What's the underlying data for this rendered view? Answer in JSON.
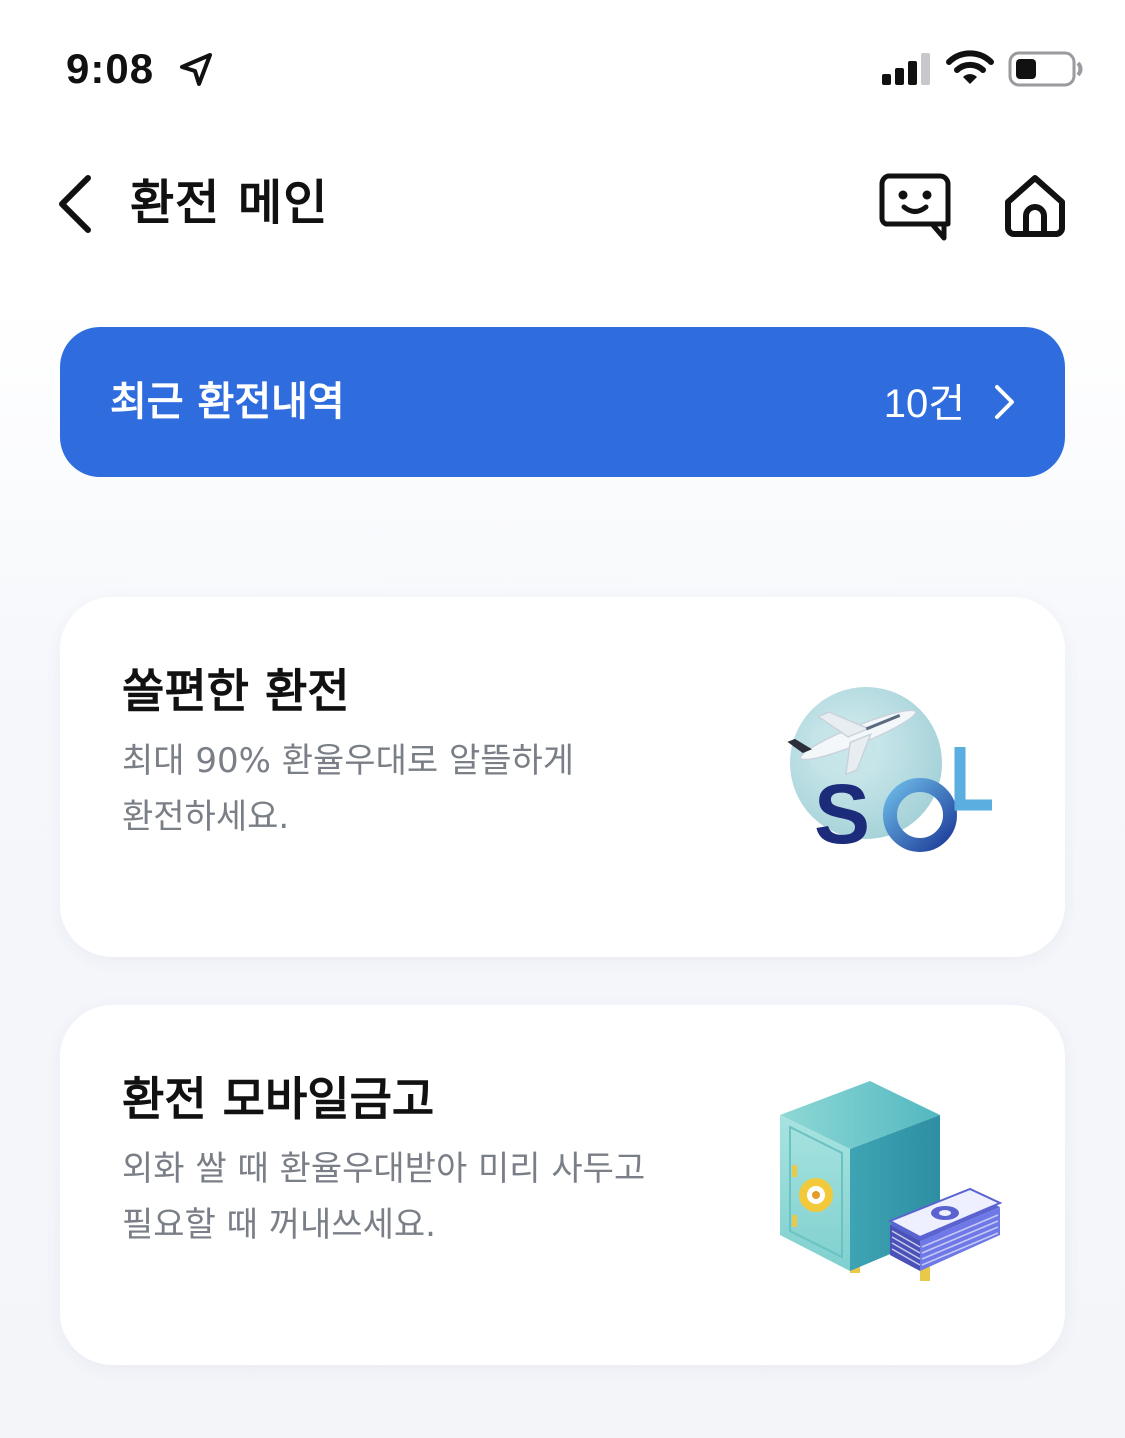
{
  "status_bar": {
    "time": "9:08",
    "icons": [
      "location-arrow-icon",
      "cellular-signal-icon",
      "wifi-icon",
      "battery-icon"
    ]
  },
  "header": {
    "title": "환전 메인",
    "back_icon": "chevron-left-icon",
    "chat_icon": "chatbot-face-icon",
    "home_icon": "home-icon"
  },
  "recent_exchange": {
    "label": "최근 환전내역",
    "count": "10건",
    "background": "#2f6ddf"
  },
  "cards": [
    {
      "title": "쏠편한 환전",
      "description_lines": [
        "최대 90% 환율우대로 알뜰하게",
        "환전하세요."
      ],
      "illustration": "sol-globe-airplane-illustration",
      "illustration_text": "SOL"
    },
    {
      "title": "환전 모바일금고",
      "description_lines": [
        "외화 쌀 때 환율우대받아 미리 사두고",
        "필요할 때 꺼내쓰세요."
      ],
      "illustration": "safe-with-cash-illustration"
    }
  ]
}
